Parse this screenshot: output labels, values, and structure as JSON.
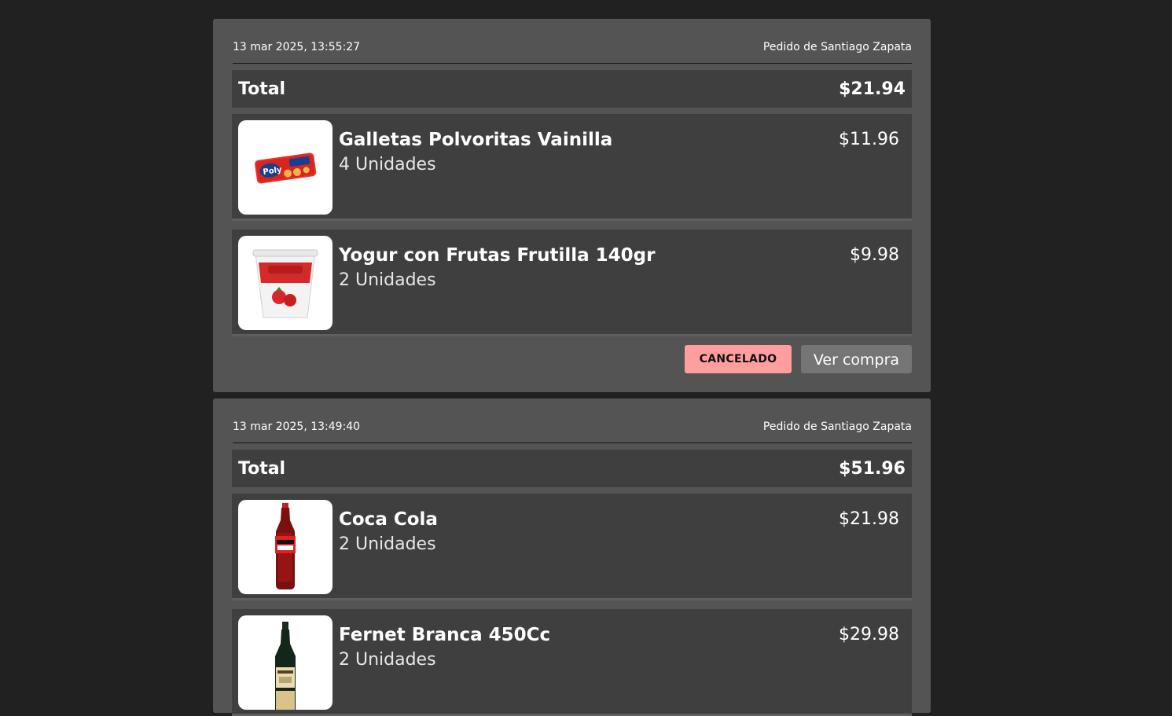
{
  "orders": [
    {
      "date": "13 mar 2025, 13:55:27",
      "customer": "Pedido de Santiago Zapata",
      "total_label": "Total",
      "total": "$21.94",
      "items": [
        {
          "name": "Galletas Polvoritas Vainilla",
          "qty": "4 Unidades",
          "price": "$11.96",
          "image": "polvoritas-cookie-pack"
        },
        {
          "name": "Yogur con Frutas Frutilla 140gr",
          "qty": "2 Unidades",
          "price": "$9.98",
          "image": "yogurt-cup"
        }
      ],
      "status": "CANCELADO",
      "status_color": "#ff9e9e",
      "action_label": "Ver compra"
    },
    {
      "date": "13 mar 2025, 13:49:40",
      "customer": "Pedido de Santiago Zapata",
      "total_label": "Total",
      "total": "$51.96",
      "items": [
        {
          "name": "Coca Cola",
          "qty": "2 Unidades",
          "price": "$21.98",
          "image": "coca-cola-bottle"
        },
        {
          "name": "Fernet Branca 450Cc",
          "qty": "2 Unidades",
          "price": "$29.98",
          "image": "fernet-bottle"
        }
      ]
    }
  ]
}
